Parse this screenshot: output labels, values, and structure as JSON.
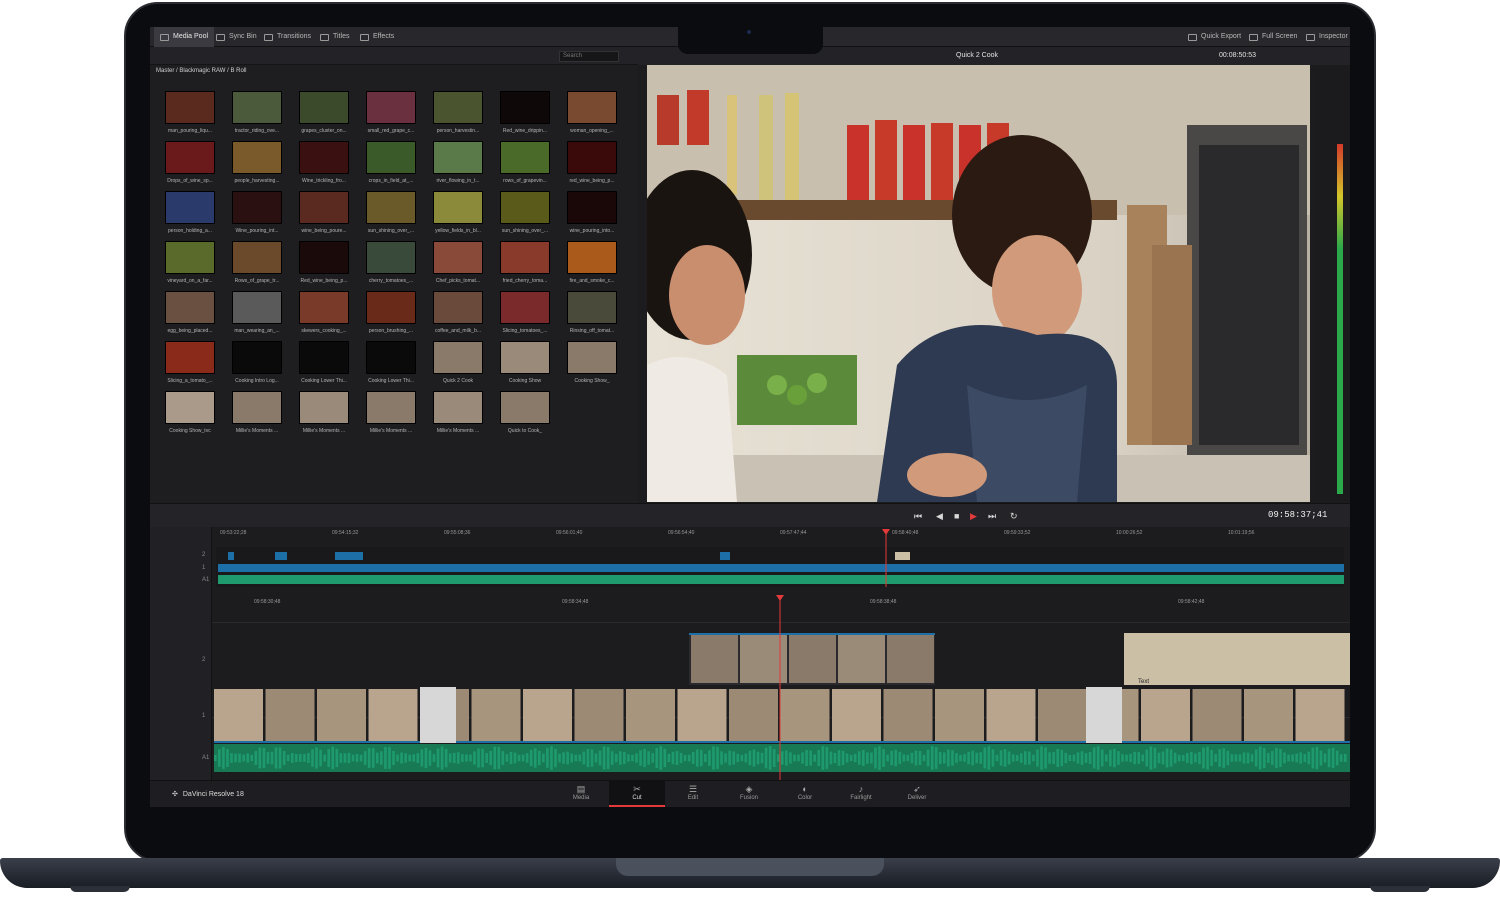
{
  "toolbar": {
    "media_pool": "Media Pool",
    "sync_bin": "Sync Bin",
    "transitions": "Transitions",
    "titles": "Titles",
    "effects": "Effects",
    "quick_export": "Quick Export",
    "full_screen": "Full Screen",
    "inspector": "Inspector"
  },
  "media_pool": {
    "breadcrumb": "Master / Blackmagic RAW / B Roll",
    "search_placeholder": "Search",
    "clips": [
      {
        "label": "man_pouring_liqu...",
        "color": "#5a2a1e"
      },
      {
        "label": "tractor_riding_ove...",
        "color": "#4a5a3a"
      },
      {
        "label": "grapes_cluster_on...",
        "color": "#3a4a2a"
      },
      {
        "label": "small_red_grape_c...",
        "color": "#6a3040"
      },
      {
        "label": "person_harvestin...",
        "color": "#4a5530"
      },
      {
        "label": "Red_wine_drippin...",
        "color": "#0e0808"
      },
      {
        "label": "woman_opening_...",
        "color": "#7a4a30"
      },
      {
        "label": "Drops_of_wine_sp...",
        "color": "#6a1a1a"
      },
      {
        "label": "people_harvesting...",
        "color": "#7a5a2a"
      },
      {
        "label": "Wine_trickling_fro...",
        "color": "#3a1010"
      },
      {
        "label": "crops_in_field_at_...",
        "color": "#3a5a2a"
      },
      {
        "label": "river_flowing_in_t...",
        "color": "#5a7a4a"
      },
      {
        "label": "rows_of_grapevin...",
        "color": "#4a6a2a"
      },
      {
        "label": "red_wine_being_p...",
        "color": "#3a0a0a"
      },
      {
        "label": "person_holding_a...",
        "color": "#2a3a6a"
      },
      {
        "label": "Wine_pouring_int...",
        "color": "#2a1010"
      },
      {
        "label": "wine_being_poure...",
        "color": "#5a2a20"
      },
      {
        "label": "sun_shining_over_...",
        "color": "#6a5a2a"
      },
      {
        "label": "yellow_fields_in_bl...",
        "color": "#8a8a3a"
      },
      {
        "label": "sun_shining_over_...",
        "color": "#5a5a1a"
      },
      {
        "label": "wine_pouring_into...",
        "color": "#1a0808"
      },
      {
        "label": "vineyard_on_a_far...",
        "color": "#5a6a2a"
      },
      {
        "label": "Rows_of_grape_tr...",
        "color": "#6a4a2a"
      },
      {
        "label": "Red_wine_being_p...",
        "color": "#1a0a0a"
      },
      {
        "label": "cherry_tomatoes_...",
        "color": "#3a4a3a"
      },
      {
        "label": "Chef_picks_tomat...",
        "color": "#8a4a3a"
      },
      {
        "label": "fried_cherry_toma...",
        "color": "#8a3a2a"
      },
      {
        "label": "fire_and_smoke_c...",
        "color": "#aa5a1a"
      },
      {
        "label": "egg_being_placed...",
        "color": "#6a5040"
      },
      {
        "label": "man_wearing_an_...",
        "color": "#5a5a5a"
      },
      {
        "label": "skewers_cooking_...",
        "color": "#7a3a2a"
      },
      {
        "label": "person_brushing_...",
        "color": "#6a2a1a"
      },
      {
        "label": "coffee_and_milk_b...",
        "color": "#6a4a3a"
      },
      {
        "label": "Slicing_tomatoes_...",
        "color": "#7a2a2a"
      },
      {
        "label": "Rinsing_off_tomat...",
        "color": "#4a4a3a"
      },
      {
        "label": "Slicing_a_tomato_...",
        "color": "#8a2a1a"
      },
      {
        "label": "Cooking Intro Log...",
        "color": "#0a0a0a"
      },
      {
        "label": "Cooking Lower Thi...",
        "color": "#0a0a0a"
      },
      {
        "label": "Cooking Lower Thi...",
        "color": "#0a0a0a"
      },
      {
        "label": "Quick 2 Cook",
        "color": "#8a7a6a"
      },
      {
        "label": "Cooking Show",
        "color": "#9a8a7a"
      },
      {
        "label": "Cooking Show_",
        "color": "#8a7a6a"
      },
      {
        "label": "Cooking Show_tvc",
        "color": "#aa9a8a"
      },
      {
        "label": "Millie's Moments ...",
        "color": "#8a7a6a"
      },
      {
        "label": "Millie's Moments ...",
        "color": "#9a8a7a"
      },
      {
        "label": "Millie's Moments ...",
        "color": "#8a7a6a"
      },
      {
        "label": "Millie's Moments ...",
        "color": "#9a8a7a"
      },
      {
        "label": "Quick to Cook_",
        "color": "#8a7a6a"
      }
    ]
  },
  "viewer": {
    "title": "Quick 2 Cook",
    "timecode_top": "00:08:50:53",
    "timecode": "09:58:37;41"
  },
  "timeline": {
    "upper_ruler": [
      "09:53:22;28",
      "09:54:15;32",
      "09:55:08;36",
      "09:56:01;40",
      "09:56:54;40",
      "09:57:47;44",
      "09:58:40;48",
      "09:59:33;52",
      "10:00:26;52",
      "10:01:19;56"
    ],
    "lower_ruler": [
      "09:58:30;48",
      "09:58:34;48",
      "09:58:38;48",
      "09:58:42;48"
    ],
    "upper_track_labels": [
      "2",
      "1",
      "A1"
    ],
    "track_labels": [
      "2",
      "1",
      "A1"
    ],
    "title_clip_label": "Text",
    "colors": {
      "video": "#1d6fa8",
      "audio": "#1e9a6e",
      "playhead": "#e23a3a",
      "title": "#cbbfa5"
    }
  },
  "pages": [
    {
      "label": "Media",
      "icon": "▤"
    },
    {
      "label": "Cut",
      "icon": "✂"
    },
    {
      "label": "Edit",
      "icon": "☰"
    },
    {
      "label": "Fusion",
      "icon": "◈"
    },
    {
      "label": "Color",
      "icon": "◐"
    },
    {
      "label": "Fairlight",
      "icon": "♪"
    },
    {
      "label": "Deliver",
      "icon": "➶"
    }
  ],
  "app_name": "DaVinci Resolve 18"
}
